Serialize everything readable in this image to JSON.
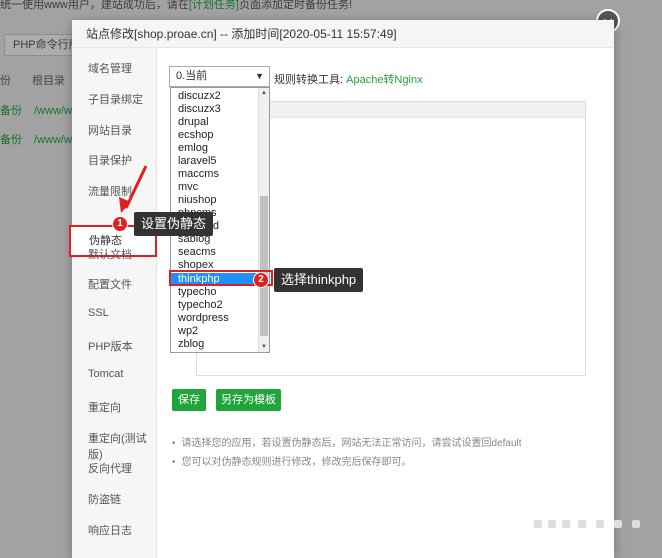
{
  "background": {
    "notice_prefix": "统一使用www用户，建站成功后，请在",
    "notice_link": "[计划任务]",
    "notice_suffix": "页面添加定时备份任务!",
    "php_cli_button": "PHP命令行版本",
    "col_partial": "份",
    "col_root": "根目录",
    "rows": [
      {
        "backup": "备份",
        "path": "/www/w"
      },
      {
        "backup": "备份",
        "path": "/www/w"
      }
    ]
  },
  "dialog": {
    "title": "站点修改[shop.proae.cn] -- 添加时间[2020-05-11 15:57:49]",
    "close_glyph": "✕",
    "sidebar": [
      "域名管理",
      "子目录绑定",
      "网站目录",
      "目录保护",
      "流量限制",
      "伪静态",
      "默认文档",
      "配置文件",
      "SSL",
      "PHP版本",
      "Tomcat",
      "重定向",
      "重定向(测试版)",
      "反向代理",
      "防盗链",
      "响应日志"
    ],
    "active_sidebar": "伪静态",
    "select": {
      "value": "0.当前",
      "caret": "▼"
    },
    "converter": {
      "label": "规则转换工具:",
      "link": "Apache转Nginx"
    },
    "dropdown_options": [
      "discuzx2",
      "discuzx3",
      "drupal",
      "ecshop",
      "emlog",
      "laravel5",
      "maccms",
      "mvc",
      "niushop",
      "phpcms",
      "phpwind",
      "sablog",
      "seacms",
      "shopex",
      "thinkphp",
      "typecho",
      "typecho2",
      "wordpress",
      "wp2",
      "zblog"
    ],
    "selected_option": "thinkphp",
    "buttons": {
      "save": "保存",
      "save_as_template": "另存为模板"
    },
    "notes": [
      "请选择您的应用，若设置伪静态后，网站无法正常访问，请尝试设置回default",
      "您可以对伪静态规则进行修改，修改完后保存即可。"
    ]
  },
  "annotations": [
    {
      "num": "1",
      "text": "设置伪静态"
    },
    {
      "num": "2",
      "text": "选择thinkphp"
    }
  ],
  "colors": {
    "accent": "#20a53a",
    "highlight": "#e02020",
    "selection": "#1e90ff"
  }
}
